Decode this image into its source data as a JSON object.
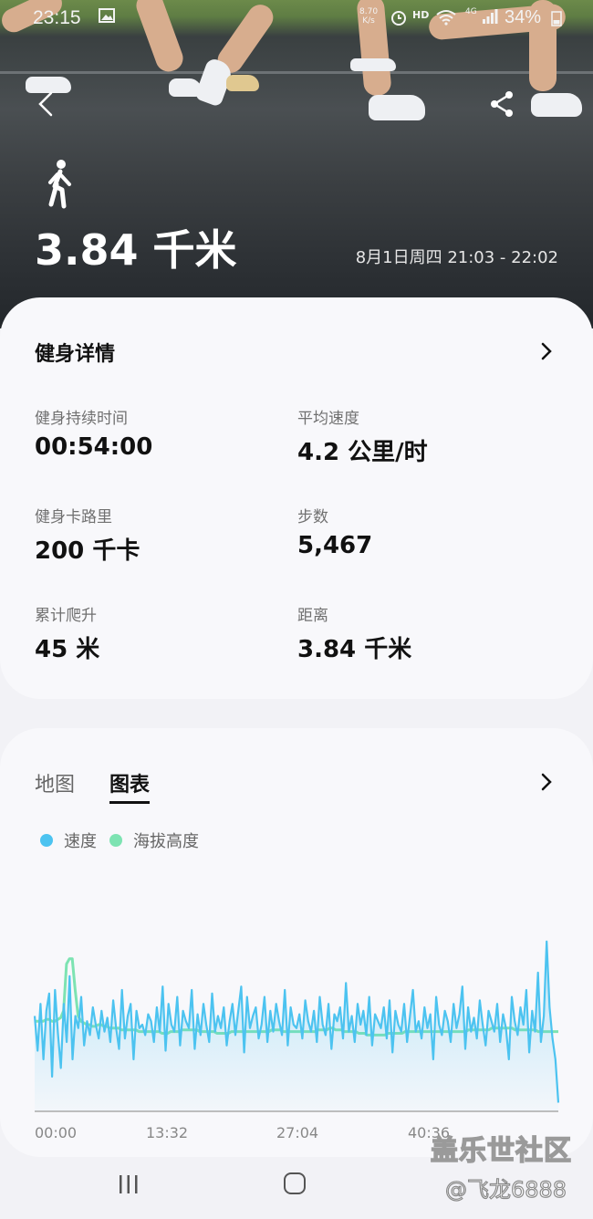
{
  "status_bar": {
    "time": "23:15",
    "net_speed": "8.70",
    "net_unit": "K/s",
    "hd": "HD",
    "network": "4G",
    "battery": "34%"
  },
  "header": {
    "distance": "3.84 千米",
    "date_range": "8月1日周四 21:03 - 22:02",
    "activity_icon": "walking-person-icon"
  },
  "details": {
    "title": "健身详情",
    "metrics": [
      {
        "label": "健身持续时间",
        "value": "00:54:00"
      },
      {
        "label": "平均速度",
        "value": "4.2 公里/时"
      },
      {
        "label": "健身卡路里",
        "value": "200 千卡"
      },
      {
        "label": "步数",
        "value": "5,467"
      },
      {
        "label": "累计爬升",
        "value": "45 米"
      },
      {
        "label": "距离",
        "value": "3.84 千米"
      }
    ]
  },
  "chart_card": {
    "tabs": [
      "地图",
      "图表"
    ],
    "active_tab": "图表",
    "legend": [
      {
        "label": "速度",
        "color": "#4cc3f0"
      },
      {
        "label": "海拔高度",
        "color": "#7de3b2"
      }
    ]
  },
  "chart_data": {
    "type": "line",
    "x_tick_labels": [
      "00:00",
      "13:32",
      "27:04",
      "40:36"
    ],
    "series": [
      {
        "name": "速度",
        "color": "#4cc3f0",
        "values": [
          0.55,
          0.35,
          0.62,
          0.3,
          0.58,
          0.68,
          0.2,
          0.7,
          0.45,
          0.25,
          0.62,
          0.4,
          0.78,
          0.3,
          0.55,
          0.48,
          0.66,
          0.38,
          0.52,
          0.44,
          0.6,
          0.5,
          0.42,
          0.58,
          0.46,
          0.54,
          0.4,
          0.64,
          0.48,
          0.36,
          0.7,
          0.42,
          0.55,
          0.62,
          0.3,
          0.58,
          0.48,
          0.5,
          0.44,
          0.56,
          0.52,
          0.4,
          0.6,
          0.46,
          0.72,
          0.35,
          0.62,
          0.5,
          0.46,
          0.66,
          0.38,
          0.58,
          0.52,
          0.48,
          0.7,
          0.36,
          0.56,
          0.44,
          0.62,
          0.5,
          0.4,
          0.68,
          0.46,
          0.55,
          0.48,
          0.6,
          0.38,
          0.52,
          0.62,
          0.44,
          0.58,
          0.72,
          0.34,
          0.66,
          0.48,
          0.55,
          0.6,
          0.42,
          0.5,
          0.66,
          0.4,
          0.58,
          0.46,
          0.62,
          0.52,
          0.44,
          0.7,
          0.38,
          0.6,
          0.5,
          0.48,
          0.56,
          0.42,
          0.64,
          0.52,
          0.46,
          0.58,
          0.4,
          0.66,
          0.5,
          0.44,
          0.62,
          0.36,
          0.56,
          0.52,
          0.6,
          0.42,
          0.74,
          0.46,
          0.55,
          0.4,
          0.62,
          0.5,
          0.58,
          0.44,
          0.66,
          0.38,
          0.56,
          0.52,
          0.48,
          0.6,
          0.42,
          0.64,
          0.34,
          0.58,
          0.5,
          0.46,
          0.62,
          0.4,
          0.55,
          0.7,
          0.46,
          0.52,
          0.42,
          0.6,
          0.48,
          0.56,
          0.3,
          0.66,
          0.5,
          0.44,
          0.58,
          0.52,
          0.4,
          0.62,
          0.48,
          0.56,
          0.72,
          0.36,
          0.6,
          0.46,
          0.54,
          0.42,
          0.64,
          0.5,
          0.38,
          0.58,
          0.52,
          0.46,
          0.62,
          0.4,
          0.56,
          0.48,
          0.3,
          0.66,
          0.52,
          0.44,
          0.6,
          0.5,
          0.7,
          0.34,
          0.58,
          0.46,
          0.8,
          0.4,
          0.55,
          0.98,
          0.6,
          0.42,
          0.3,
          0.05
        ],
        "fill": true
      },
      {
        "name": "海拔高度",
        "color": "#7de3b2",
        "values": [
          0.52,
          0.52,
          0.52,
          0.52,
          0.53,
          0.53,
          0.52,
          0.52,
          0.53,
          0.54,
          0.58,
          0.85,
          0.88,
          0.88,
          0.7,
          0.55,
          0.52,
          0.51,
          0.5,
          0.5,
          0.49,
          0.49,
          0.5,
          0.5,
          0.49,
          0.49,
          0.48,
          0.48,
          0.48,
          0.48,
          0.47,
          0.47,
          0.47,
          0.47,
          0.47,
          0.47,
          0.46,
          0.46,
          0.46,
          0.46,
          0.46,
          0.46,
          0.46,
          0.46,
          0.45,
          0.45,
          0.45,
          0.46,
          0.46,
          0.46,
          0.46,
          0.47,
          0.47,
          0.47,
          0.47,
          0.47,
          0.47,
          0.46,
          0.46,
          0.46,
          0.46,
          0.46,
          0.46,
          0.45,
          0.45,
          0.45,
          0.45,
          0.45,
          0.46,
          0.46,
          0.46,
          0.46,
          0.46,
          0.46,
          0.46,
          0.46,
          0.46,
          0.46,
          0.46,
          0.46,
          0.46,
          0.46,
          0.47,
          0.47,
          0.47,
          0.47,
          0.46,
          0.46,
          0.46,
          0.46,
          0.46,
          0.46,
          0.46,
          0.46,
          0.46,
          0.46,
          0.46,
          0.46,
          0.47,
          0.47,
          0.47,
          0.47,
          0.48,
          0.48,
          0.47,
          0.47,
          0.47,
          0.46,
          0.46,
          0.46,
          0.46,
          0.46,
          0.45,
          0.45,
          0.45,
          0.44,
          0.44,
          0.44,
          0.44,
          0.44,
          0.44,
          0.44,
          0.45,
          0.45,
          0.45,
          0.45,
          0.45,
          0.45,
          0.46,
          0.46,
          0.46,
          0.46,
          0.46,
          0.46,
          0.46,
          0.46,
          0.46,
          0.46,
          0.46,
          0.46,
          0.46,
          0.46,
          0.46,
          0.46,
          0.46,
          0.46,
          0.46,
          0.46,
          0.46,
          0.46,
          0.47,
          0.47,
          0.47,
          0.47,
          0.47,
          0.47,
          0.47,
          0.47,
          0.48,
          0.48,
          0.48,
          0.48,
          0.48,
          0.48,
          0.48,
          0.48,
          0.47,
          0.47,
          0.47,
          0.47,
          0.47,
          0.47,
          0.47,
          0.47,
          0.46,
          0.46,
          0.46,
          0.46,
          0.46,
          0.46,
          0.46,
          0.46
        ]
      }
    ],
    "ylim": [
      0,
      1
    ],
    "grid": false,
    "legend_position": "top-left"
  },
  "nav": {
    "recent_icon": "recent-apps-icon",
    "home_icon": "home-icon"
  },
  "watermark": {
    "line1": "盖乐世社区",
    "line2": "@飞龙6888"
  }
}
